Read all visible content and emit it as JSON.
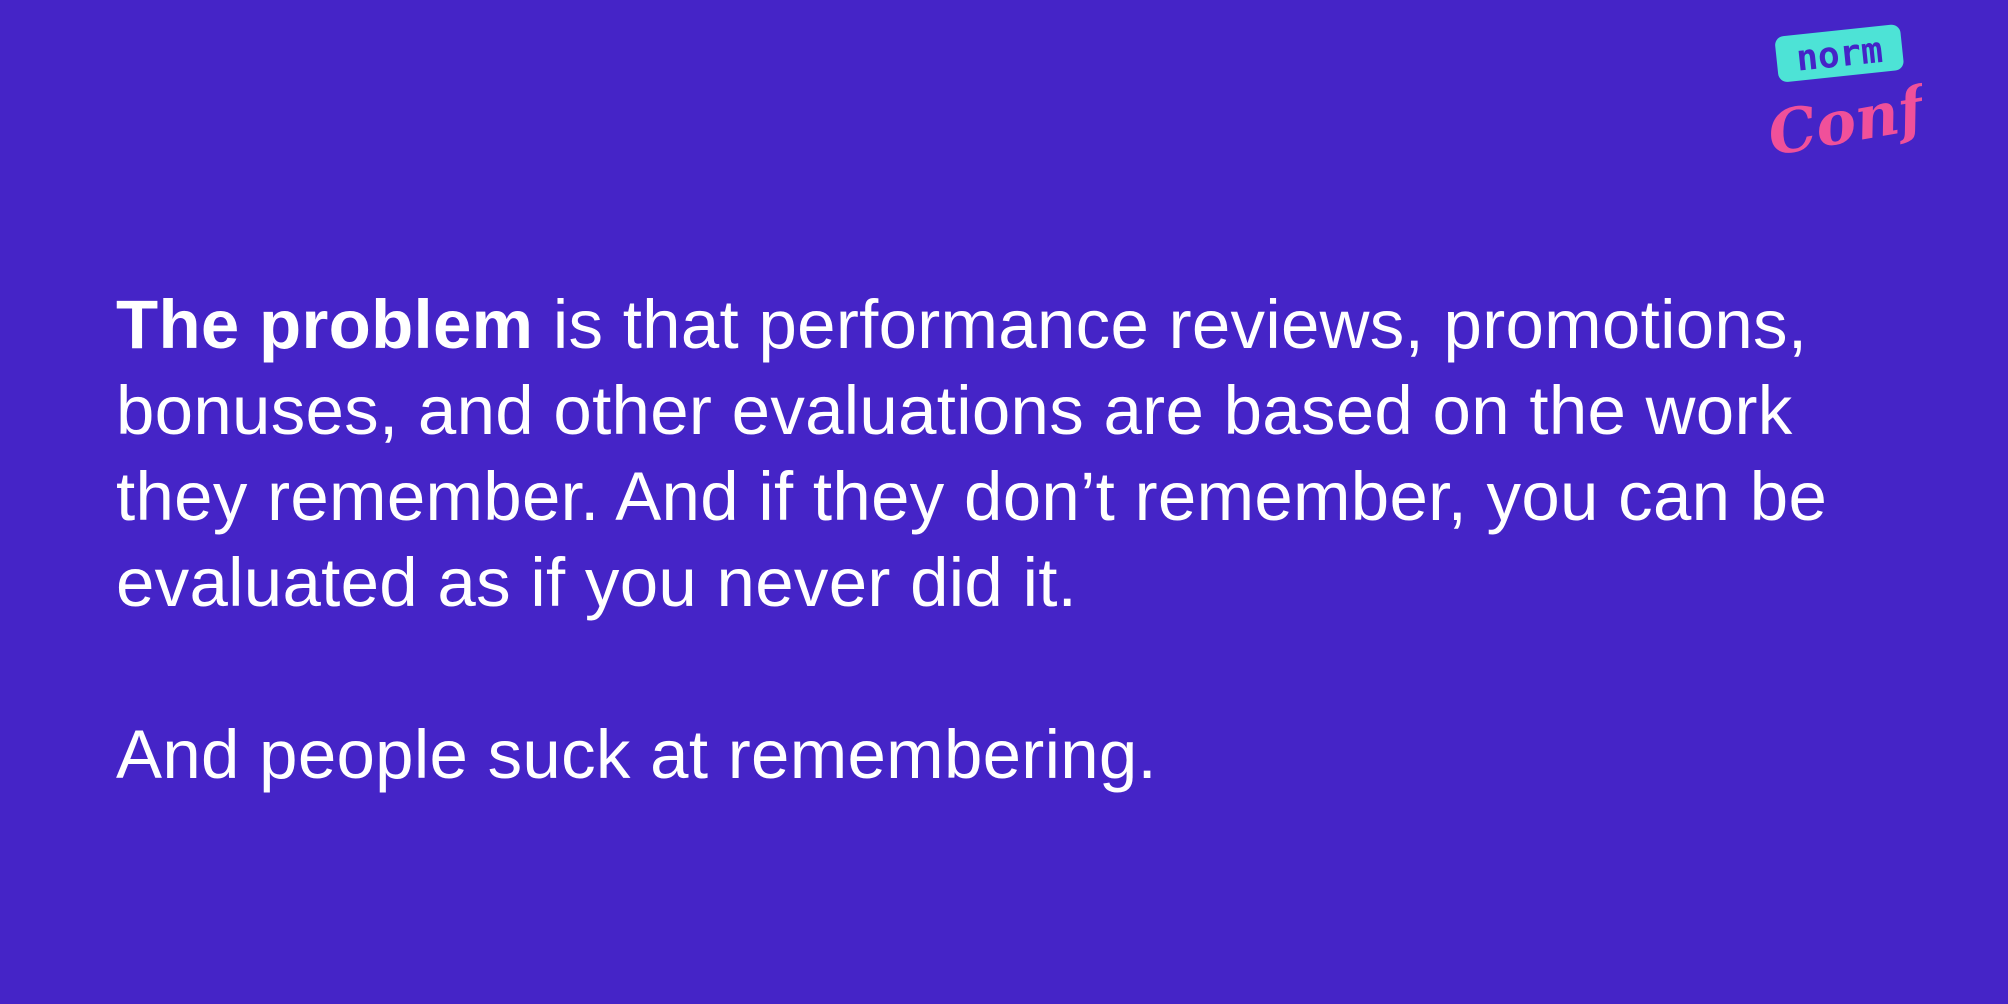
{
  "slide": {
    "background": "#4524c7",
    "logo": {
      "word_top": "norm",
      "word_bottom": "Conf",
      "badge_color": "#4de3d6",
      "script_color": "#f0509a"
    },
    "paragraph1": {
      "emphasis": "The problem",
      "rest": " is that performance reviews, promotions, bonuses, and other evaluations are based on the work they remember. And if they don’t remember, you can be evaluated as if you never did it."
    },
    "paragraph2": "And people suck at remembering."
  }
}
